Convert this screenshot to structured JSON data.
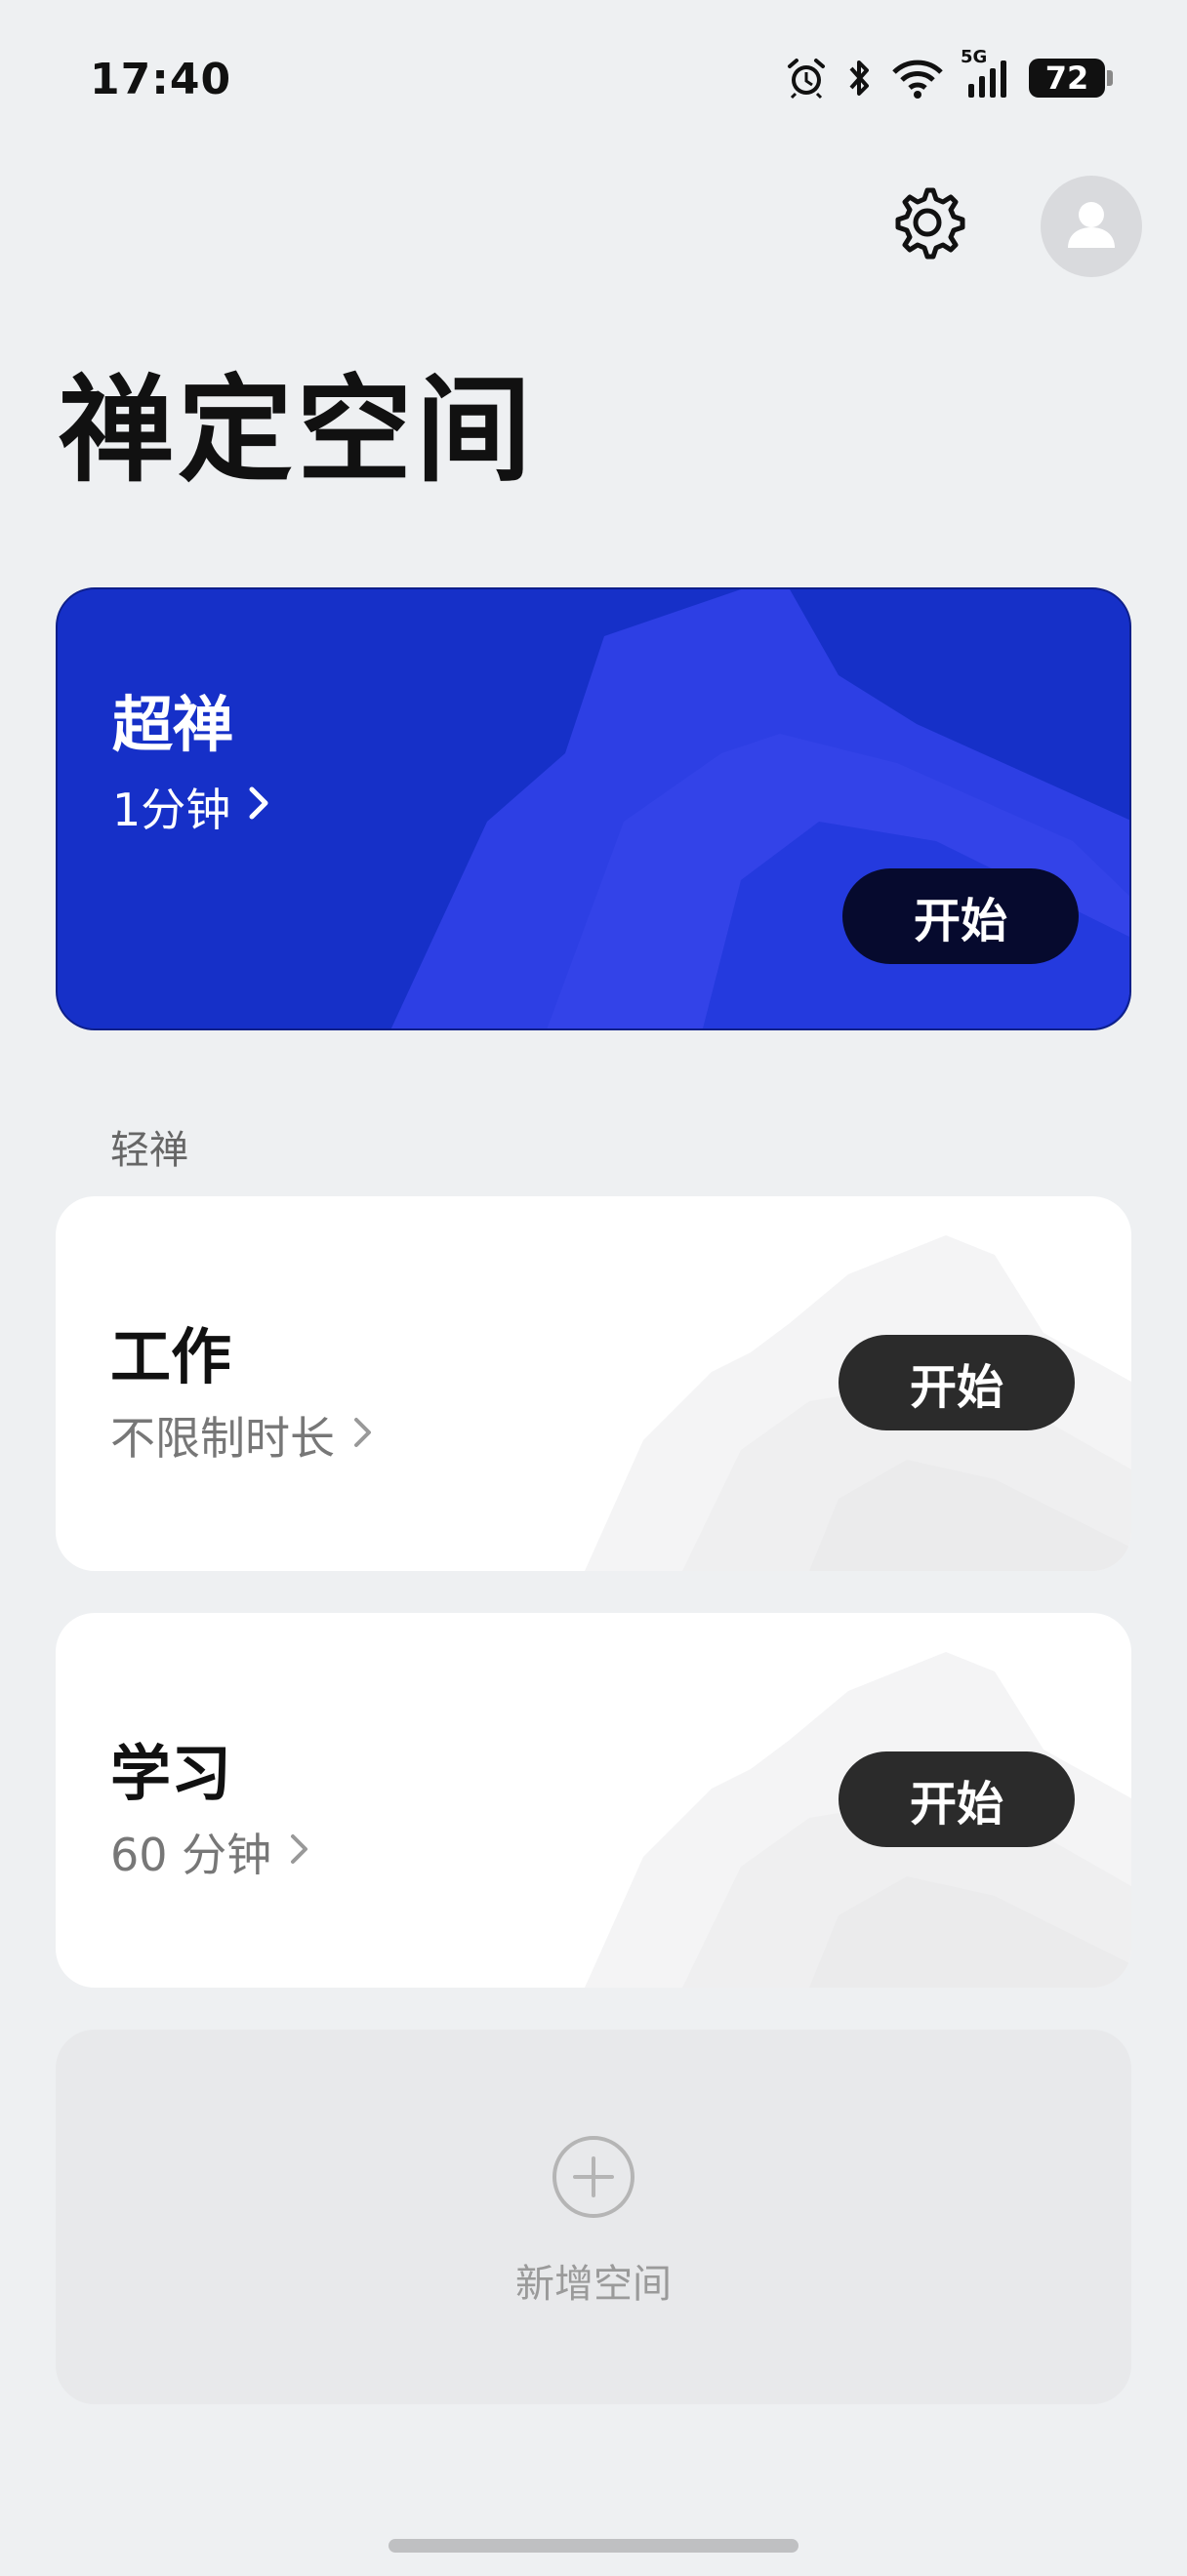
{
  "status_bar": {
    "time": "17:40",
    "network": "5G",
    "battery": "72",
    "icons": [
      "alarm-icon",
      "bluetooth-icon",
      "wifi-icon",
      "signal-icon",
      "battery-icon"
    ]
  },
  "header": {
    "title": "禅定空间",
    "icons": [
      "gear-icon",
      "avatar-icon"
    ]
  },
  "hero_card": {
    "title": "超禅",
    "subtitle": "1分钟",
    "start_label": "开始",
    "color": "#1630c8"
  },
  "section": {
    "label": "轻禅"
  },
  "spaces": [
    {
      "title": "工作",
      "subtitle": "不限制时长",
      "start_label": "开始"
    },
    {
      "title": "学习",
      "subtitle": "60 分钟",
      "start_label": "开始"
    }
  ],
  "add_space": {
    "label": "新增空间",
    "icon": "plus-circle-icon"
  }
}
